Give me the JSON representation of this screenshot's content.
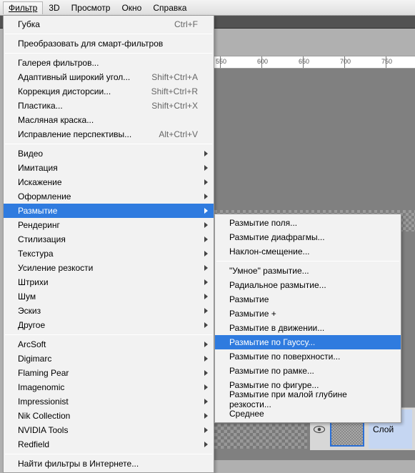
{
  "menubar": {
    "items": [
      {
        "full": "Фильтр",
        "accel_index": 0
      },
      {
        "full": "3D",
        "accel_index": 0
      },
      {
        "full": "Просмотр",
        "accel_index": 0
      },
      {
        "full": "Окно",
        "accel_index": 0
      },
      {
        "full": "Справка",
        "accel_index": 0
      }
    ]
  },
  "ruler_ticks": [
    "550",
    "600",
    "650",
    "700",
    "750"
  ],
  "filter_menu": {
    "sections": [
      [
        {
          "label": "Губка",
          "shortcut": "Ctrl+F"
        }
      ],
      [
        {
          "label": "Преобразовать для смарт-фильтров"
        }
      ],
      [
        {
          "label": "Галерея фильтров..."
        },
        {
          "label": "Адаптивный широкий угол...",
          "shortcut": "Shift+Ctrl+A"
        },
        {
          "label": "Коррекция дисторсии...",
          "shortcut": "Shift+Ctrl+R"
        },
        {
          "label": "Пластика...",
          "shortcut": "Shift+Ctrl+X"
        },
        {
          "label": "Масляная краска..."
        },
        {
          "label": "Исправление перспективы...",
          "shortcut": "Alt+Ctrl+V"
        }
      ],
      [
        {
          "label": "Видео",
          "submenu": true
        },
        {
          "label": "Имитация",
          "submenu": true
        },
        {
          "label": "Искажение",
          "submenu": true
        },
        {
          "label": "Оформление",
          "submenu": true
        },
        {
          "label": "Размытие",
          "submenu": true,
          "highlight": true
        },
        {
          "label": "Рендеринг",
          "submenu": true
        },
        {
          "label": "Стилизация",
          "submenu": true
        },
        {
          "label": "Текстура",
          "submenu": true
        },
        {
          "label": "Усиление резкости",
          "submenu": true
        },
        {
          "label": "Штрихи",
          "submenu": true
        },
        {
          "label": "Шум",
          "submenu": true
        },
        {
          "label": "Эскиз",
          "submenu": true
        },
        {
          "label": "Другое",
          "submenu": true
        }
      ],
      [
        {
          "label": "ArcSoft",
          "submenu": true
        },
        {
          "label": "Digimarc",
          "submenu": true
        },
        {
          "label": "Flaming Pear",
          "submenu": true
        },
        {
          "label": "Imagenomic",
          "submenu": true
        },
        {
          "label": "Impressionist",
          "submenu": true
        },
        {
          "label": "Nik Collection",
          "submenu": true
        },
        {
          "label": "NVIDIA Tools",
          "submenu": true
        },
        {
          "label": "Redfield",
          "submenu": true
        }
      ],
      [
        {
          "label": "Найти фильтры в Интернете..."
        }
      ]
    ]
  },
  "blur_submenu": {
    "sections": [
      [
        {
          "label": "Размытие поля..."
        },
        {
          "label": "Размытие диафрагмы..."
        },
        {
          "label": "Наклон-смещение..."
        }
      ],
      [
        {
          "label": "\"Умное\" размытие..."
        },
        {
          "label": "Радиальное размытие..."
        },
        {
          "label": "Размытие"
        },
        {
          "label": "Размытие +"
        },
        {
          "label": "Размытие в движении..."
        },
        {
          "label": "Размытие по Гауссу...",
          "highlight": true
        },
        {
          "label": "Размытие по поверхности..."
        },
        {
          "label": "Размытие по рамке..."
        },
        {
          "label": "Размытие по фигуре..."
        },
        {
          "label": "Размытие при малой глубине резкости..."
        },
        {
          "label": "Среднее"
        }
      ]
    ]
  },
  "layer": {
    "name": "Слой"
  }
}
